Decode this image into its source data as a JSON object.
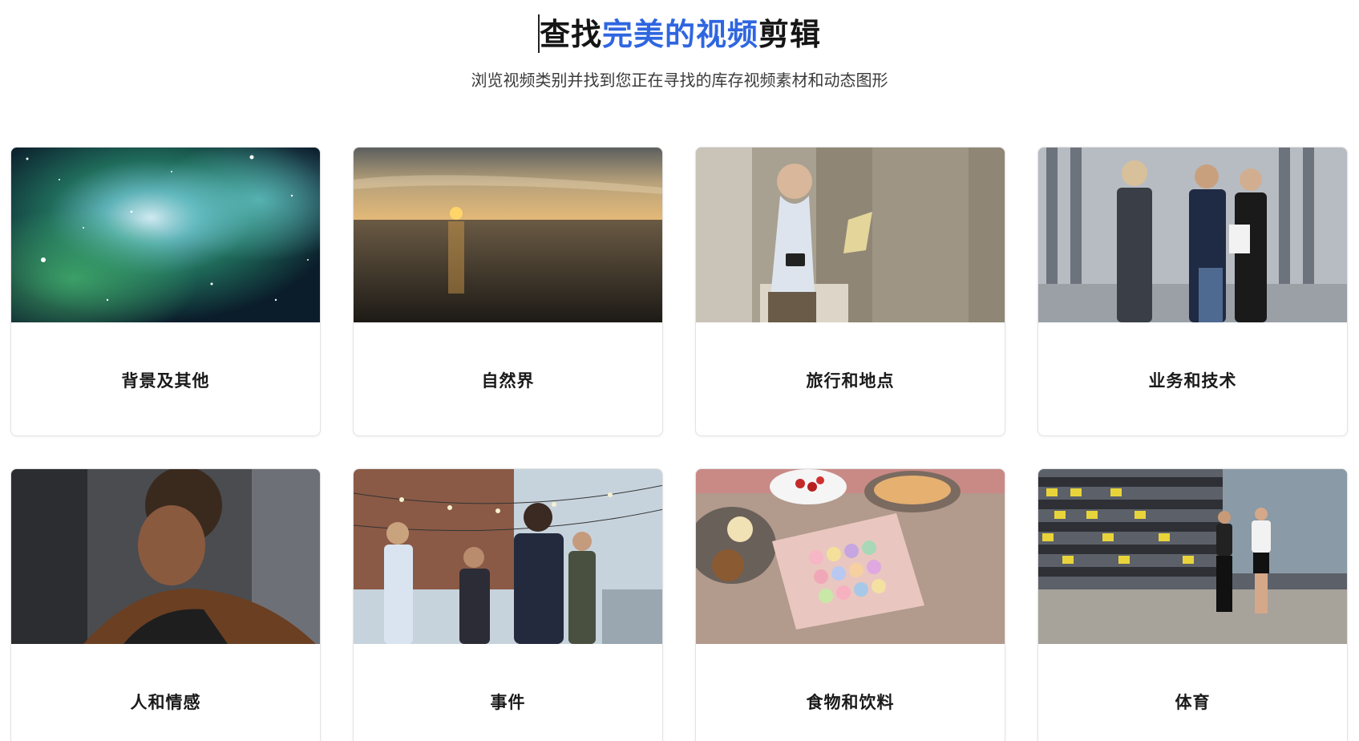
{
  "header": {
    "title_prefix": "查找",
    "title_accent": "完美的视频",
    "title_suffix": "剪辑",
    "subtitle": "浏览视频类别并找到您正在寻找的库存视频素材和动态图形",
    "accent_color": "#2f66e0"
  },
  "categories": [
    {
      "label": "背景及其他",
      "image": "nebula-space-image"
    },
    {
      "label": "自然界",
      "image": "ocean-sunset-image"
    },
    {
      "label": "旅行和地点",
      "image": "tourist-with-map-image"
    },
    {
      "label": "业务和技术",
      "image": "business-people-image"
    },
    {
      "label": "人和情感",
      "image": "woman-emotion-image"
    },
    {
      "label": "事件",
      "image": "party-crowd-image"
    },
    {
      "label": "食物和饮料",
      "image": "macarons-food-image"
    },
    {
      "label": "体育",
      "image": "stadium-runners-image"
    }
  ]
}
